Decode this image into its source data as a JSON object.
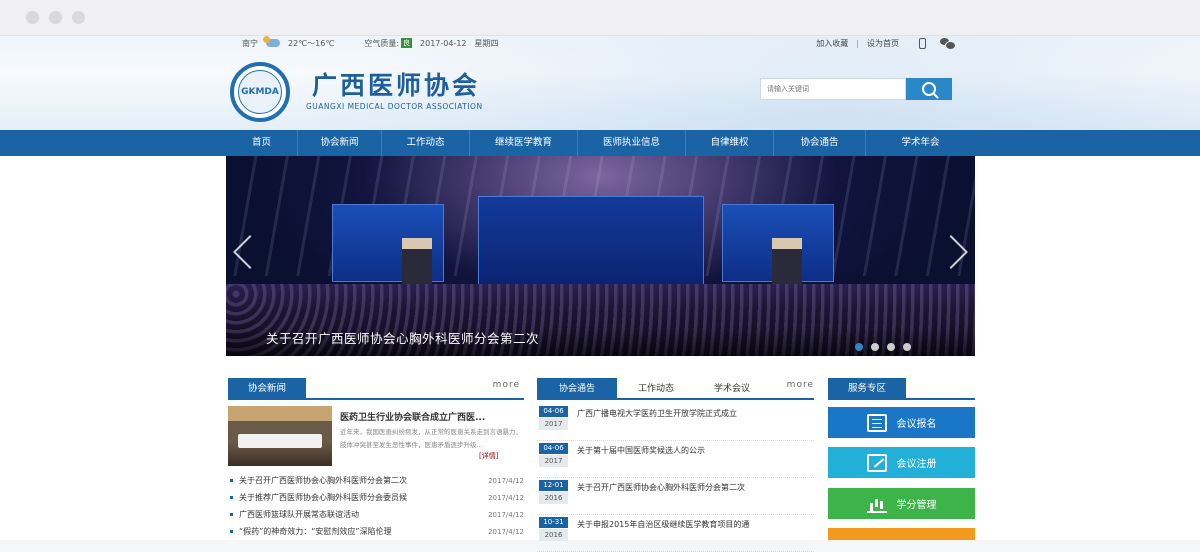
{
  "topbar": {
    "city": "南宁",
    "weather_icon": "partly-cloudy-icon",
    "temperature": "22℃～16℃",
    "air_label": "空气质量:",
    "air_value": "良",
    "date": "2017-04-12",
    "weekday": "星期四",
    "favorite": "加入收藏",
    "separator": "|",
    "homepage": "设为首页"
  },
  "header": {
    "logo_text": "GKMDA",
    "title": "广西医师协会",
    "subtitle": "GUANGXI MEDICAL DOCTOR ASSOCIATION",
    "search_placeholder": "请输入关键词"
  },
  "nav": {
    "items": [
      "首页",
      "协会新闻",
      "工作动态",
      "继续医学教育",
      "医师执业信息",
      "自律维权",
      "协会通告",
      "学术年会"
    ]
  },
  "banner": {
    "caption": "关于召开广西医师协会心胸外科医师分会第二次",
    "slide_count": 4,
    "active_slide": 1
  },
  "news": {
    "tab": "协会新闻",
    "more": "more",
    "featured_title": "医药卫生行业协会联合成立广西医...",
    "featured_desc": "近年来，我国医患纠纷频发，从正常的医患关系走到言语暴力，肢体冲突甚至发生恶性事件，医患矛盾逐步升级...",
    "featured_more": "[详情]",
    "items": [
      {
        "title": "关于召开广西医师协会心胸外科医师分会第二次",
        "date": "2017/4/12"
      },
      {
        "title": "关于推荐广西医师协会心胸外科医师分会委员候",
        "date": "2017/4/12"
      },
      {
        "title": "广西医师篮球队开展常态联谊活动",
        "date": "2017/4/12"
      },
      {
        "title": "“假药”的神奇效力：“安慰剂效应”深陷伦理",
        "date": "2017/4/12"
      }
    ]
  },
  "notices": {
    "tabs": [
      "协会通告",
      "工作动态",
      "学术会议"
    ],
    "more": "more",
    "items": [
      {
        "md": "04-06",
        "year": "2017",
        "title": "广西广播电视大学医药卫生开放学院正式成立"
      },
      {
        "md": "04-06",
        "year": "2017",
        "title": "关于第十届中国医师奖候选人的公示"
      },
      {
        "md": "12-01",
        "year": "2016",
        "title": "关于召开广西医师协会心胸外科医师分会第二次"
      },
      {
        "md": "10-31",
        "year": "2016",
        "title": "关于申报2015年自治区级继续医学教育项目的通"
      }
    ]
  },
  "services": {
    "tab": "服务专区",
    "buttons": [
      {
        "label": "会议报名",
        "icon": "form-icon",
        "color": "#1a77c8"
      },
      {
        "label": "会议注册",
        "icon": "edit-icon",
        "color": "#22b0d8"
      },
      {
        "label": "学分管理",
        "icon": "bar-chart-icon",
        "color": "#3cb449"
      },
      {
        "label": "",
        "icon": "",
        "color": "#f39a1e"
      }
    ]
  }
}
